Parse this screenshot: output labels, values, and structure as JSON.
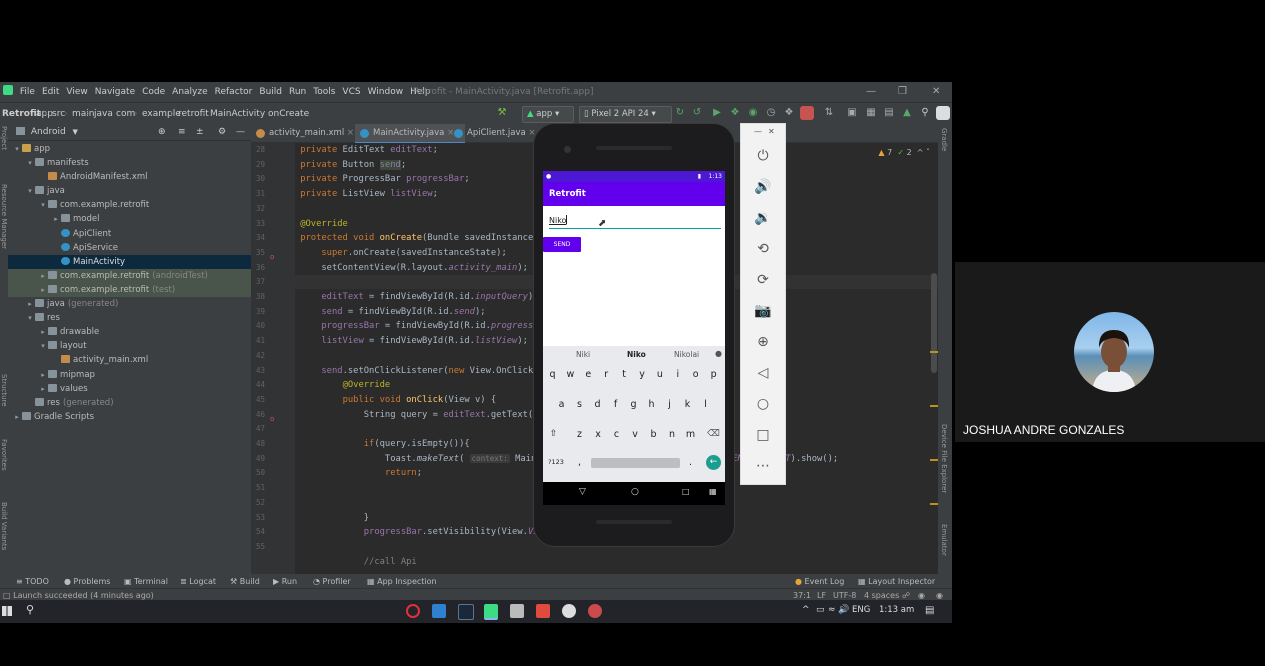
{
  "ide": {
    "menu": [
      "File",
      "Edit",
      "View",
      "Navigate",
      "Code",
      "Analyze",
      "Refactor",
      "Build",
      "Run",
      "Tools",
      "VCS",
      "Window",
      "Help"
    ],
    "window_title": "Retrofit - MainActivity.java [Retrofit.app]",
    "breadcrumbs": [
      "Retrofit",
      "app",
      "src",
      "main",
      "java",
      "com",
      "example",
      "retrofit",
      "MainActivity",
      "onCreate"
    ],
    "run_config": "app",
    "device": "Pixel 2 API 24",
    "project_view": "Android",
    "tree": [
      {
        "label": "app",
        "indent": 0,
        "icon": "fold-y",
        "arrow": "▾"
      },
      {
        "label": "manifests",
        "indent": 1,
        "icon": "fold",
        "arrow": "▾"
      },
      {
        "label": "AndroidManifest.xml",
        "indent": 2,
        "icon": "xml",
        "arrow": ""
      },
      {
        "label": "java",
        "indent": 1,
        "icon": "fold",
        "arrow": "▾"
      },
      {
        "label": "com.example.retrofit",
        "indent": 2,
        "icon": "fold",
        "arrow": "▾"
      },
      {
        "label": "model",
        "indent": 3,
        "icon": "fold",
        "arrow": "▸"
      },
      {
        "label": "ApiClient",
        "indent": 3,
        "icon": "cls",
        "arrow": ""
      },
      {
        "label": "ApiService",
        "indent": 3,
        "icon": "cls",
        "arrow": ""
      },
      {
        "label": "MainActivity",
        "indent": 3,
        "icon": "cls",
        "arrow": "",
        "state": "sel"
      },
      {
        "label": "com.example.retrofit",
        "suffix": "(androidTest)",
        "indent": 2,
        "icon": "fold",
        "arrow": "▸",
        "state": "test"
      },
      {
        "label": "com.example.retrofit",
        "suffix": "(test)",
        "indent": 2,
        "icon": "fold",
        "arrow": "▸",
        "state": "test"
      },
      {
        "label": "java",
        "suffix": "(generated)",
        "indent": 1,
        "icon": "fold",
        "arrow": "▸"
      },
      {
        "label": "res",
        "indent": 1,
        "icon": "fold",
        "arrow": "▾"
      },
      {
        "label": "drawable",
        "indent": 2,
        "icon": "fold",
        "arrow": "▸"
      },
      {
        "label": "layout",
        "indent": 2,
        "icon": "fold",
        "arrow": "▾"
      },
      {
        "label": "activity_main.xml",
        "indent": 3,
        "icon": "xml",
        "arrow": ""
      },
      {
        "label": "mipmap",
        "indent": 2,
        "icon": "fold",
        "arrow": "▸"
      },
      {
        "label": "values",
        "indent": 2,
        "icon": "fold",
        "arrow": "▸"
      },
      {
        "label": "res",
        "suffix": "(generated)",
        "indent": 1,
        "icon": "fold",
        "arrow": ""
      },
      {
        "label": "Gradle Scripts",
        "indent": 0,
        "icon": "fold",
        "arrow": "▸"
      }
    ],
    "tabs": [
      {
        "label": "activity_main.xml",
        "color": "#c38c4a",
        "active": false
      },
      {
        "label": "MainActivity.java",
        "color": "#3592c4",
        "active": true
      },
      {
        "label": "ApiClient.java",
        "color": "#3592c4",
        "active": false
      }
    ],
    "line_numbers": [
      "28",
      "29",
      "30",
      "31",
      "32",
      "33",
      "34",
      "35",
      "36",
      "37",
      "38",
      "39",
      "40",
      "41",
      "42",
      "43",
      "44",
      "45",
      "46",
      "47",
      "48",
      "49",
      "50",
      "51",
      "52",
      "53",
      "54",
      "55"
    ],
    "code_lines": [
      {
        "html": "    <span class='kw'>private</span> EditText <span class='fld'>editText</span>;"
      },
      {
        "html": "    <span class='kw'>private</span> Button <span class='fld' style='background:#3b4b3b'>send</span>;"
      },
      {
        "html": "    <span class='kw'>private</span> ProgressBar <span class='fld'>progressBar</span>;"
      },
      {
        "html": "    <span class='kw'>private</span> ListView <span class='fld'>listView</span>;"
      },
      {
        "html": ""
      },
      {
        "html": "    <span class='ann'>@Override</span>"
      },
      {
        "html": "    <span class='kw'>protected void</span> <span class='fn'>onCreate</span>(Bundle savedInstanceState) {"
      },
      {
        "html": "        <span class='kw'>super</span>.onCreate(savedInstanceState);"
      },
      {
        "html": "        setContentView(R.layout.<span class='fld it'>activity_main</span>);"
      },
      {
        "html": ""
      },
      {
        "html": "        <span class='fld'>editText</span> = findViewById(R.id.<span class='fld it'>inputQuery</span>);"
      },
      {
        "html": "        <span class='fld'>send</span> = findViewById(R.id.<span class='fld it'>send</span>);"
      },
      {
        "html": "        <span class='fld'>progressBar</span> = findViewById(R.id.<span class='fld it'>progressBar</span>);"
      },
      {
        "html": "        <span class='fld'>listView</span> = findViewById(R.id.<span class='fld it'>listView</span>);"
      },
      {
        "html": ""
      },
      {
        "html": "        <span class='fld'>send</span>.setOnClickListener(<span class='kw'>new</span> View.OnClickListener() {"
      },
      {
        "html": "            <span class='ann'>@Override</span>"
      },
      {
        "html": "            <span class='kw'>public void</span> <span class='fn'>onClick</span>(View v) {"
      },
      {
        "html": "                String query = <span class='fld'>editText</span>.getText().toString();"
      },
      {
        "html": ""
      },
      {
        "html": "                <span class='kw'>if</span>(query.isEmpty()){"
      },
      {
        "html": "                    Toast.<span class='it'>makeText</span>( <span class='hint'>context:</span> MainActivity.<span class='kw'>this</span>, <span class='str'>\"Empty query\"</span>, Toast.<span class='fld it'>LENGTH_SHORT</span>).show();"
      },
      {
        "html": "                    <span class='kw'>return</span>;"
      },
      {
        "html": ""
      },
      {
        "html": ""
      },
      {
        "html": "                }"
      },
      {
        "html": "                <span class='fld'>progressBar</span>.setVisibility(View.<span class='fld it'>VISIBLE</span>);"
      },
      {
        "html": ""
      },
      {
        "html": "                <span class='cm'>//call Api</span>"
      }
    ],
    "inspection": {
      "warnings": "7",
      "weak": "2"
    },
    "bottom_tabs": [
      "TODO",
      "Problems",
      "Terminal",
      "Logcat",
      "Build",
      "Run",
      "Profiler",
      "App Inspection"
    ],
    "bottom_right_tabs": [
      "Event Log",
      "Layout Inspector"
    ],
    "status_message": "Launch succeeded (4 minutes ago)",
    "status_right": [
      "37:1",
      "LF",
      "UTF-8",
      "4 spaces"
    ],
    "left_strip": [
      "Project",
      "Resource Manager",
      "Structure",
      "Favorites",
      "Build Variants"
    ],
    "right_strip": [
      "Gradle",
      "Device File Explorer",
      "Emulator"
    ]
  },
  "taskbar": {
    "lang": "ENG",
    "time": "1:13 am"
  },
  "phone": {
    "status_time": "1:13",
    "app_title": "Retrofit",
    "input_value": "Niko",
    "send_label": "SEND",
    "suggestions": [
      "Niki",
      "Niko",
      "Nikolai"
    ],
    "row1": [
      "q",
      "w",
      "e",
      "r",
      "t",
      "y",
      "u",
      "i",
      "o",
      "p"
    ],
    "row2": [
      "a",
      "s",
      "d",
      "f",
      "g",
      "h",
      "j",
      "k",
      "l"
    ],
    "row3": [
      "z",
      "x",
      "c",
      "v",
      "b",
      "n",
      "m"
    ],
    "sym_key": "?123",
    "comma": ",",
    "period": "."
  },
  "emulator_icons": [
    "power-icon",
    "volume-up-icon",
    "volume-down-icon",
    "rotate-left-icon",
    "rotate-right-icon",
    "camera-icon",
    "zoom-icon",
    "back-icon",
    "home-icon",
    "overview-icon",
    "more-icon"
  ],
  "participant": {
    "name": "JOSHUA ANDRE GONZALES"
  }
}
